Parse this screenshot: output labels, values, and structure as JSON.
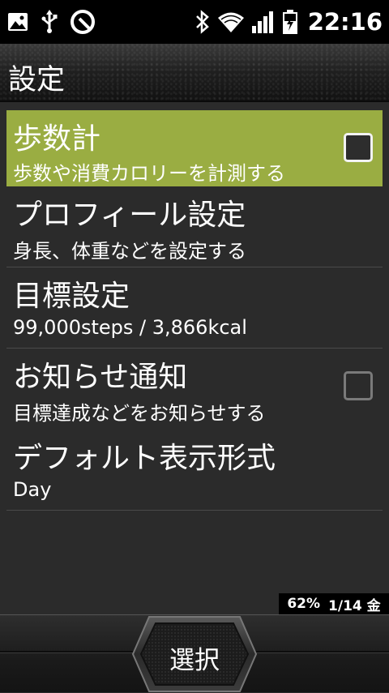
{
  "status_bar": {
    "time": "22:16",
    "icons_left": [
      "gallery-icon",
      "usb-icon",
      "app-notification-icon"
    ],
    "icons_right": [
      "bluetooth-icon",
      "wifi-icon",
      "signal-icon",
      "battery-icon"
    ],
    "battery_level": 0.62
  },
  "header": {
    "title": "設定"
  },
  "settings": {
    "items": [
      {
        "title": "歩数計",
        "subtitle": "歩数や消費カロリーを計測する",
        "has_checkbox": true,
        "checked": false,
        "selected": true
      },
      {
        "title": "プロフィール設定",
        "subtitle": "身長、体重などを設定する",
        "has_checkbox": false,
        "selected": false
      },
      {
        "title": "目標設定",
        "subtitle": "99,000steps / 3,866kcal",
        "has_checkbox": false,
        "selected": false
      },
      {
        "title": "お知らせ通知",
        "subtitle": "目標達成などをお知らせする",
        "has_checkbox": true,
        "checked": false,
        "selected": false
      },
      {
        "title": "デフォルト表示形式",
        "subtitle": "Day",
        "has_checkbox": false,
        "selected": false
      }
    ]
  },
  "info": {
    "battery_percent": "62%",
    "date": "1/14 金"
  },
  "softkeys": {
    "center_label": "選択"
  },
  "colors": {
    "selected_row": "#9aad42",
    "background": "#2b2b2b",
    "status_bar": "#000000"
  }
}
